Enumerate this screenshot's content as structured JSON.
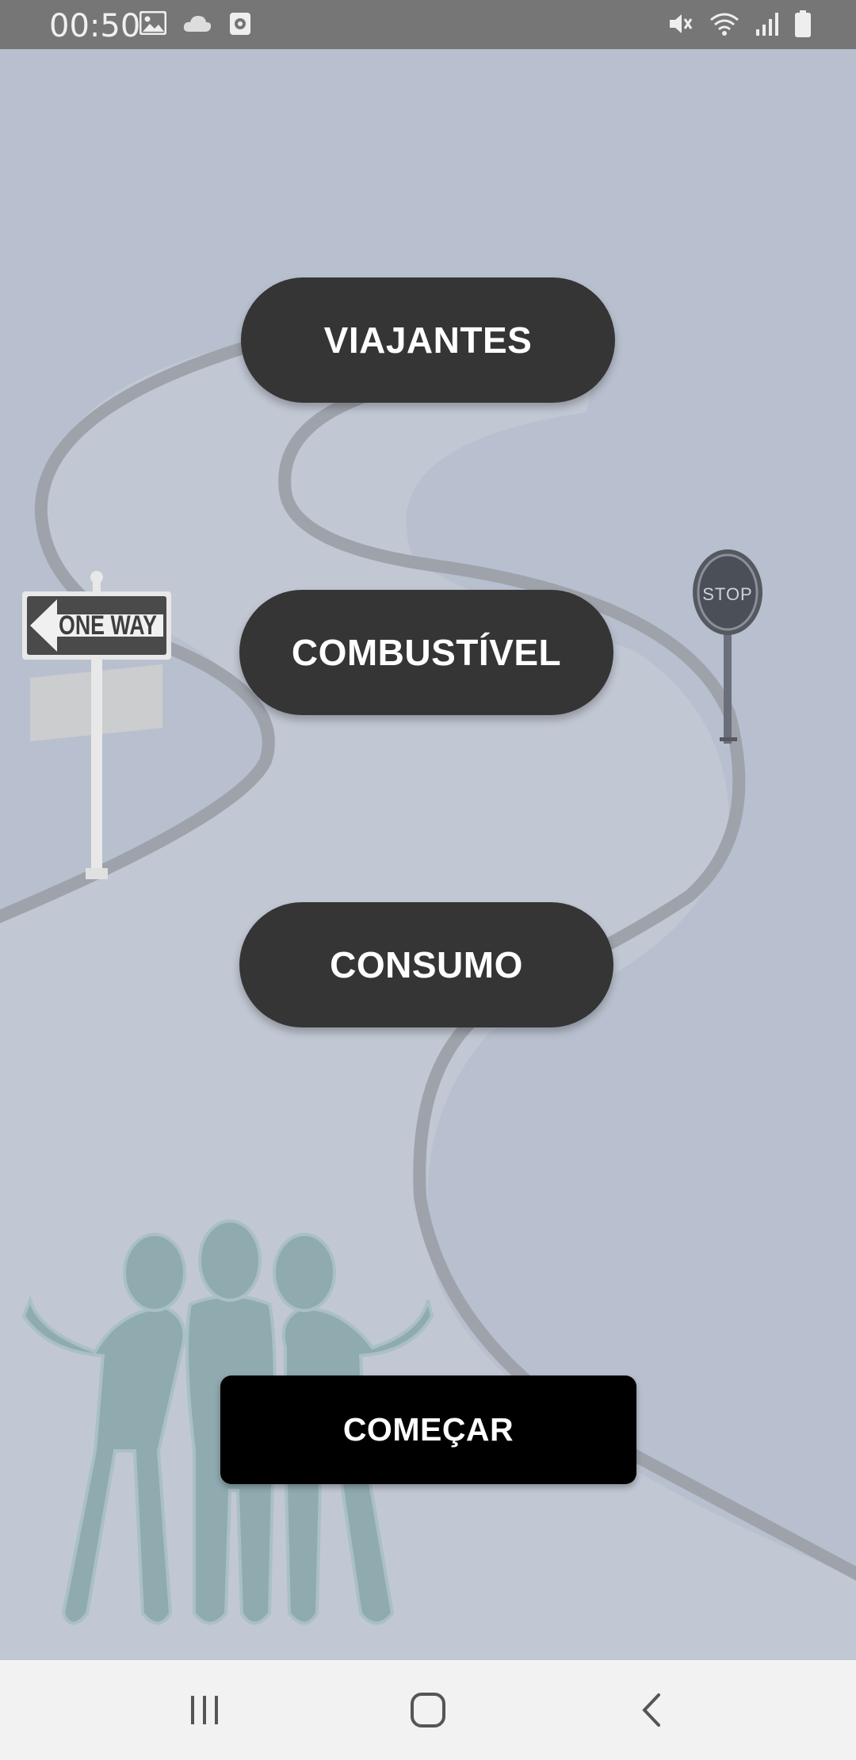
{
  "status_bar": {
    "time": "00:50",
    "left_icons": [
      "image-icon",
      "cloud-icon",
      "screen-record-icon"
    ],
    "right_icons": [
      "mute-icon",
      "wifi-icon",
      "signal-icon",
      "battery-icon"
    ]
  },
  "illustration": {
    "one_way_sign_text": "ONE WAY",
    "stop_sign_text": "STOP"
  },
  "menu": {
    "viajantes_label": "VIAJANTES",
    "combustivel_label": "COMBUSTÍVEL",
    "consumo_label": "CONSUMO"
  },
  "start_button_label": "COMEÇAR",
  "navigation": [
    "recents-icon",
    "home-icon",
    "back-icon"
  ],
  "colors": {
    "background": "#b8c0cf",
    "road": "#9ea3ab",
    "pill_button": "#353535",
    "start_button": "#000000",
    "people": "#8fabb0"
  }
}
